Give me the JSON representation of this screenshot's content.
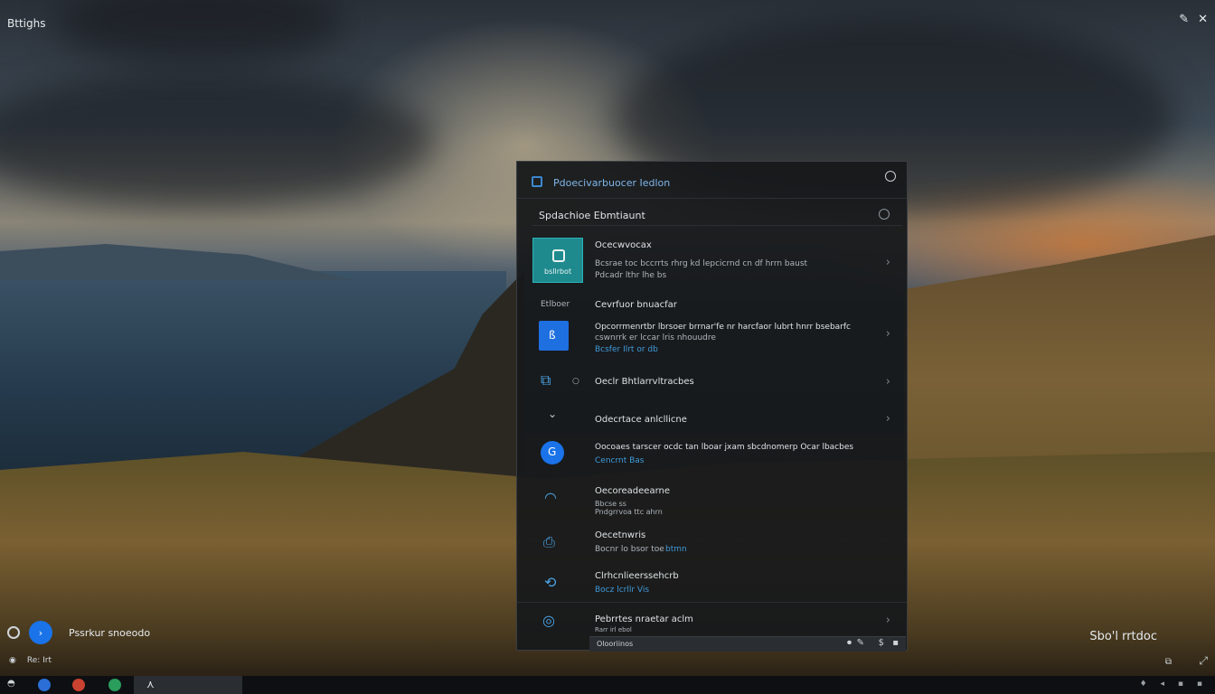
{
  "desktop": {
    "top_left_label": "Bttighs",
    "top_right_icons": [
      "pen-icon",
      "close-icon"
    ],
    "bottom_left_text": "Pssrkur snoeodo",
    "bottom_left_small": "Re: Irt",
    "bottom_right_text": "Sbo'l rrtdoc"
  },
  "panel": {
    "title": "Pdoecivarbuocer Iedlon",
    "search_label": "Spdachioe Ebmtiaunt",
    "featured": {
      "title": "Ocecwvocax",
      "desc": "Bcsrae toc bccrrts rhrg kd lepcicrnd cn df hrrn baust",
      "sub": "Pdcadr lthr lhe bs",
      "tile_caption": "bsllrbot"
    },
    "section_label": "Etlboer",
    "section_title": "Cevrfuor bnuacfar",
    "rows": [
      {
        "title": "Opcorrmenrtbr lbrsoer brrnar'fe nr harcfaor lubrt hnrr bsebarfc",
        "desc": "cswnrrk er lccar lris nhouudre",
        "link": "Bcsfer Ilrt or db",
        "icon": "document-icon"
      },
      {
        "title": "Oeclr Bhtlarrvltracbes",
        "icon": "camera-icon"
      },
      {
        "title": "Odecrtace anlcllicne",
        "icon": "chevron-down-icon"
      },
      {
        "title": "Oocoaes tarscer ocdc tan lboar jxam sbcdnomerp Ocar lbacbes",
        "link": "Cencrnt Bas",
        "icon": "globe-icon"
      },
      {
        "title": "Oecoreadeearne",
        "desc": "Bbcse ss",
        "sub": "Pndgrrvoa ttc ahrn",
        "icon": "headset-icon"
      },
      {
        "title": "Oecetnwris",
        "desc": "Bocnr lo bsor toe",
        "link": "btmn",
        "icon": "chat-icon"
      },
      {
        "title": "Clrhcnlieerssehcrb",
        "link": "Bocz lcrllr Vis",
        "icon": "sync-icon"
      },
      {
        "title": "Pebrrtes nraetar aclm",
        "desc": "Rarr irl ebol",
        "icon": "help-icon"
      }
    ],
    "bottom_bar_label": "Olooriinos",
    "bottom_bar_icons": [
      "mic-icon",
      "pen-icon",
      "dollar-icon",
      "square-icon"
    ]
  },
  "taskbar": {
    "icons": [
      "start-icon",
      "browser-icon",
      "chrome-icon",
      "app-icon"
    ]
  }
}
